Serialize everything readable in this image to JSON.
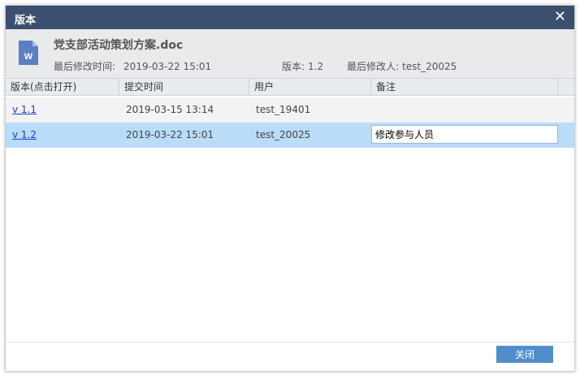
{
  "dialog": {
    "title": "版本",
    "close_glyph": "✕"
  },
  "file": {
    "icon": "word-document-icon",
    "icon_letter": "W",
    "icon_color": "#5b7fc0",
    "name": "党支部活动策划方案.doc",
    "modified_label": "最后修改时间:",
    "modified_value": "2019-03-22 15:01",
    "version_label": "版本:",
    "version_value": "1.2",
    "modifier_label": "最后修改人:",
    "modifier_value": "test_20025"
  },
  "table": {
    "headers": [
      "版本(点击打开)",
      "提交时间",
      "用户",
      "备注"
    ],
    "rows": [
      {
        "version": "v 1.1",
        "time": "2019-03-15 13:14",
        "user": "test_19401",
        "remark": ""
      },
      {
        "version": "v 1.2",
        "time": "2019-03-22 15:01",
        "user": "test_20025",
        "remark": "修改参与人员",
        "selected": true
      }
    ]
  },
  "footer": {
    "close_label": "关闭"
  },
  "colors": {
    "titlebar": "#3b4f6e",
    "selected_row": "#b9dcf8",
    "button": "#4f8ec8",
    "link": "#1a3bcc"
  }
}
